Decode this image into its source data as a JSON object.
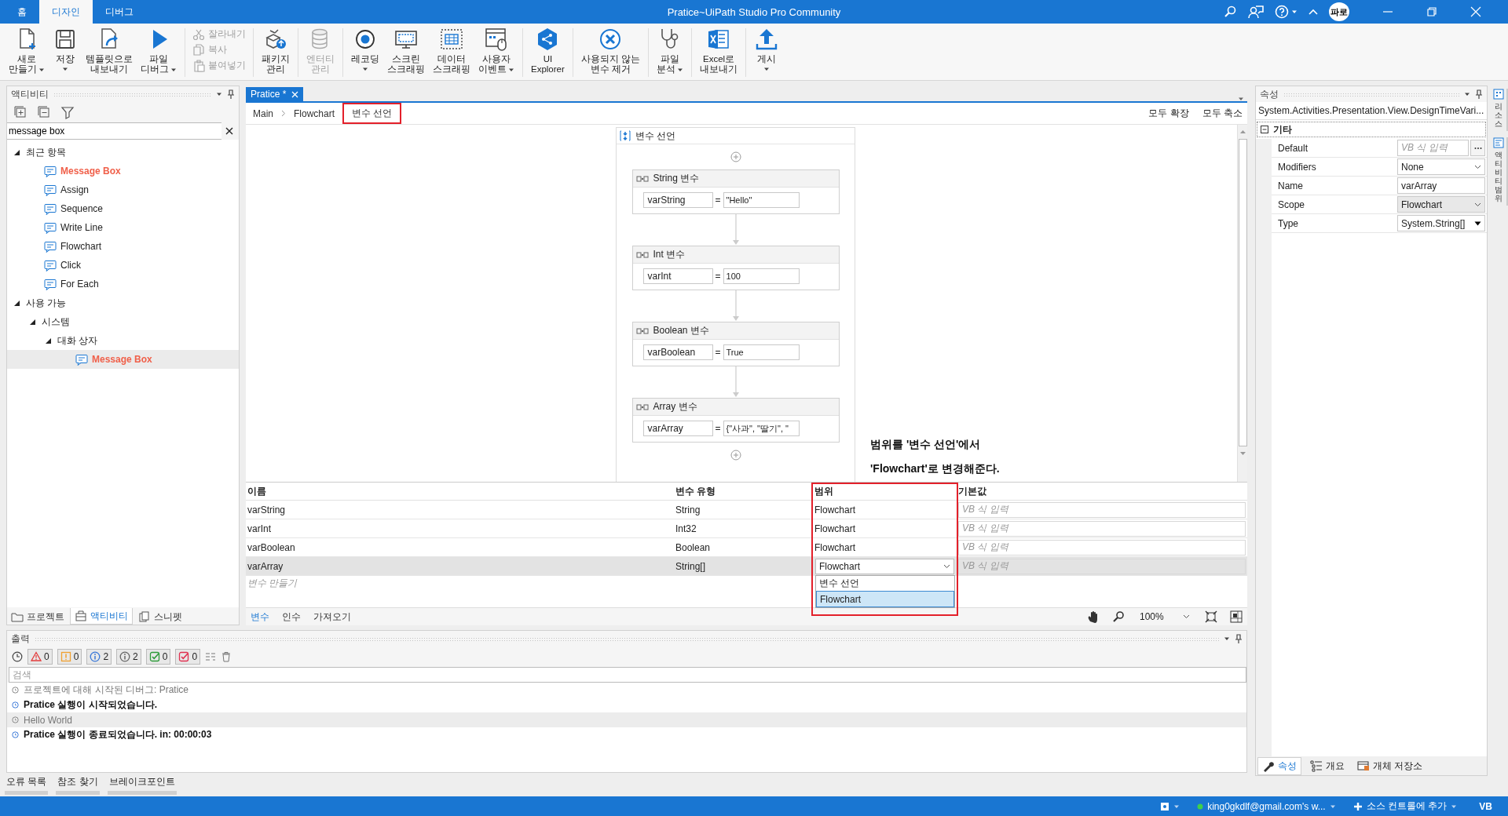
{
  "window": {
    "title": "Pratice~UiPath Studio Pro Community",
    "account_initials": "파로"
  },
  "ribbon_tabs": [
    {
      "label": "홈",
      "selected": false
    },
    {
      "label": "디자인",
      "selected": true
    },
    {
      "label": "디버그",
      "selected": false
    }
  ],
  "ribbon": [
    {
      "kind": "large",
      "buttons": [
        {
          "label": "새로\n만들기",
          "dropdown": true,
          "disabled": false
        },
        {
          "label": "저장",
          "dropdown": true,
          "disabled": false
        },
        {
          "label": "템플릿으로\n내보내기",
          "dropdown": false,
          "disabled": false
        },
        {
          "label": "파일\n디버그",
          "dropdown": true,
          "disabled": false
        }
      ]
    },
    {
      "kind": "stack",
      "buttons": [
        {
          "label": "잘라내기",
          "disabled": true
        },
        {
          "label": "복사",
          "disabled": true
        },
        {
          "label": "붙여넣기",
          "disabled": true
        }
      ]
    },
    {
      "kind": "large",
      "buttons": [
        {
          "label": "패키지\n관리",
          "dropdown": false,
          "disabled": false
        }
      ]
    },
    {
      "kind": "large",
      "buttons": [
        {
          "label": "엔터티\n관리",
          "dropdown": false,
          "disabled": true
        }
      ]
    },
    {
      "kind": "large",
      "buttons": [
        {
          "label": "레코딩",
          "dropdown": true,
          "disabled": false
        },
        {
          "label": "스크린\n스크래핑",
          "dropdown": false,
          "disabled": false
        },
        {
          "label": "데이터\n스크래핑",
          "dropdown": false,
          "disabled": false
        },
        {
          "label": "사용자\n이벤트",
          "dropdown": true,
          "disabled": false
        }
      ]
    },
    {
      "kind": "large",
      "buttons": [
        {
          "label": "UI\nExplorer",
          "dropdown": false,
          "disabled": false
        }
      ]
    },
    {
      "kind": "large",
      "buttons": [
        {
          "label": "사용되지 않는\n변수 제거",
          "dropdown": false,
          "disabled": false
        }
      ]
    },
    {
      "kind": "large",
      "buttons": [
        {
          "label": "파일\n분석",
          "dropdown": true,
          "disabled": false
        }
      ]
    },
    {
      "kind": "large",
      "buttons": [
        {
          "label": "Excel로\n내보내기",
          "dropdown": false,
          "disabled": false
        }
      ]
    },
    {
      "kind": "large",
      "buttons": [
        {
          "label": "게시",
          "dropdown": true,
          "disabled": false
        }
      ]
    }
  ],
  "activities_panel": {
    "title": "액티비티",
    "search": {
      "value": "message box"
    },
    "tree": [
      {
        "label": "최근 항목",
        "expanded": true,
        "selected": false,
        "children": [
          {
            "label": "Message Box",
            "match": true,
            "selected": false
          },
          {
            "label": "Assign",
            "match": false,
            "selected": false
          },
          {
            "label": "Sequence",
            "match": false,
            "selected": false
          },
          {
            "label": "Write Line",
            "match": false,
            "selected": false
          },
          {
            "label": "Flowchart",
            "match": false,
            "selected": false
          },
          {
            "label": "Click",
            "match": false,
            "selected": false
          },
          {
            "label": "For Each",
            "match": false,
            "selected": false
          }
        ]
      },
      {
        "label": "사용 가능",
        "expanded": true,
        "selected": false,
        "children": [
          {
            "label": "시스템",
            "expanded": true,
            "selected": false,
            "children": [
              {
                "label": "대화 상자",
                "expanded": true,
                "selected": false,
                "children": [
                  {
                    "label": "Message Box",
                    "match": true,
                    "selected": true
                  }
                ]
              }
            ]
          }
        ]
      }
    ],
    "tabs": [
      {
        "label": "프로젝트",
        "selected": false
      },
      {
        "label": "액티비티",
        "selected": true
      },
      {
        "label": "스니펫",
        "selected": false
      }
    ]
  },
  "document_tabs": [
    {
      "label": "Pratice *",
      "selected": true
    }
  ],
  "breadcrumb": [
    {
      "label": "Main",
      "highlighted": false
    },
    {
      "label": "Flowchart",
      "highlighted": false
    },
    {
      "label": "변수 선언",
      "highlighted": true
    }
  ],
  "designer_actions": [
    "모두 확장",
    "모두 축소"
  ],
  "sequence": {
    "title": "변수 선언",
    "activities": [
      {
        "title": "String 변수",
        "to": "varString",
        "operator": "=",
        "value": "\"Hello\""
      },
      {
        "title": "Int 변수",
        "to": "varInt",
        "operator": "=",
        "value": "100"
      },
      {
        "title": "Boolean 변수",
        "to": "varBoolean",
        "operator": "=",
        "value": "True"
      },
      {
        "title": "Array 변수",
        "to": "varArray",
        "operator": "=",
        "value": "{\"사과\", \"딸기\", \""
      }
    ]
  },
  "annotation": "범위를 '변수 선언'에서\n'Flowchart'로 변경해준다.",
  "variables": {
    "columns": [
      {
        "label": "이름",
        "highlighted": false
      },
      {
        "label": "변수 유형",
        "highlighted": false
      },
      {
        "label": "범위",
        "highlighted": true
      },
      {
        "label": "기본값",
        "highlighted": false
      }
    ],
    "rows": [
      {
        "name": "varString",
        "type": "String",
        "scope": "Flowchart",
        "default_placeholder": "VB 식 입력",
        "selected": false,
        "editing": false
      },
      {
        "name": "varInt",
        "type": "Int32",
        "scope": "Flowchart",
        "default_placeholder": "VB 식 입력",
        "selected": false,
        "editing": false
      },
      {
        "name": "varBoolean",
        "type": "Boolean",
        "scope": "Flowchart",
        "default_placeholder": "VB 식 입력",
        "selected": false,
        "editing": false
      },
      {
        "name": "varArray",
        "type": "String[]",
        "scope": "Flowchart",
        "default_placeholder": "VB 식 입력",
        "selected": true,
        "editing": true
      }
    ],
    "scope_options": [
      {
        "label": "변수 선언",
        "selected": false
      },
      {
        "label": "Flowchart",
        "selected": true
      }
    ],
    "new_placeholder": "변수 만들기"
  },
  "designer_tabs": [
    {
      "label": "변수",
      "selected": true
    },
    {
      "label": "인수",
      "selected": false
    },
    {
      "label": "가져오기",
      "selected": false
    }
  ],
  "zoom": "100%",
  "output": {
    "title": "출력",
    "filters": [
      {
        "kind": "error",
        "count": "0"
      },
      {
        "kind": "warning",
        "count": "0"
      },
      {
        "kind": "info",
        "count": "2"
      },
      {
        "kind": "trace",
        "count": "2"
      },
      {
        "kind": "success",
        "count": "0"
      },
      {
        "kind": "failure",
        "count": "0"
      }
    ],
    "search_placeholder": "검색",
    "lines": [
      {
        "text": "프로젝트에 대해 시작된 디버그: Pratice",
        "kind": "trace",
        "selected": false
      },
      {
        "text": "Pratice 실행이 시작되었습니다.",
        "kind": "info",
        "selected": false
      },
      {
        "text": "Hello World",
        "kind": "trace",
        "selected": true
      },
      {
        "text": "Pratice 실행이 종료되었습니다. in: 00:00:03",
        "kind": "info",
        "selected": false
      }
    ]
  },
  "bottom_tabs": [
    "오류 목록",
    "참조 찾기",
    "브레이크포인트"
  ],
  "properties": {
    "title": "속성",
    "type_name": "System.Activities.Presentation.View.DesignTimeVari...",
    "category": {
      "label": "기타",
      "expanded": true
    },
    "rows": [
      {
        "name": "Default",
        "kind": "expression",
        "placeholder": "VB 식 입력",
        "focused": false
      },
      {
        "name": "Modifiers",
        "kind": "dropdown",
        "value": "None",
        "focused": false
      },
      {
        "name": "Name",
        "kind": "text",
        "value": "varArray",
        "focused": false
      },
      {
        "name": "Scope",
        "kind": "dropdown",
        "value": "Flowchart",
        "focused": true
      },
      {
        "name": "Type",
        "kind": "combo",
        "value": "System.String[]",
        "focused": false
      }
    ],
    "tabs": [
      {
        "label": "속성",
        "selected": true
      },
      {
        "label": "개요",
        "selected": false
      },
      {
        "label": "개체 저장소",
        "selected": false
      }
    ]
  },
  "side_tabs": [
    "리소스",
    "액티비티 범위"
  ],
  "status_bar": {
    "account": "king0gkdlf@gmail.com's w...",
    "source_control": "소스 컨트롤에 추가",
    "language": "VB"
  }
}
